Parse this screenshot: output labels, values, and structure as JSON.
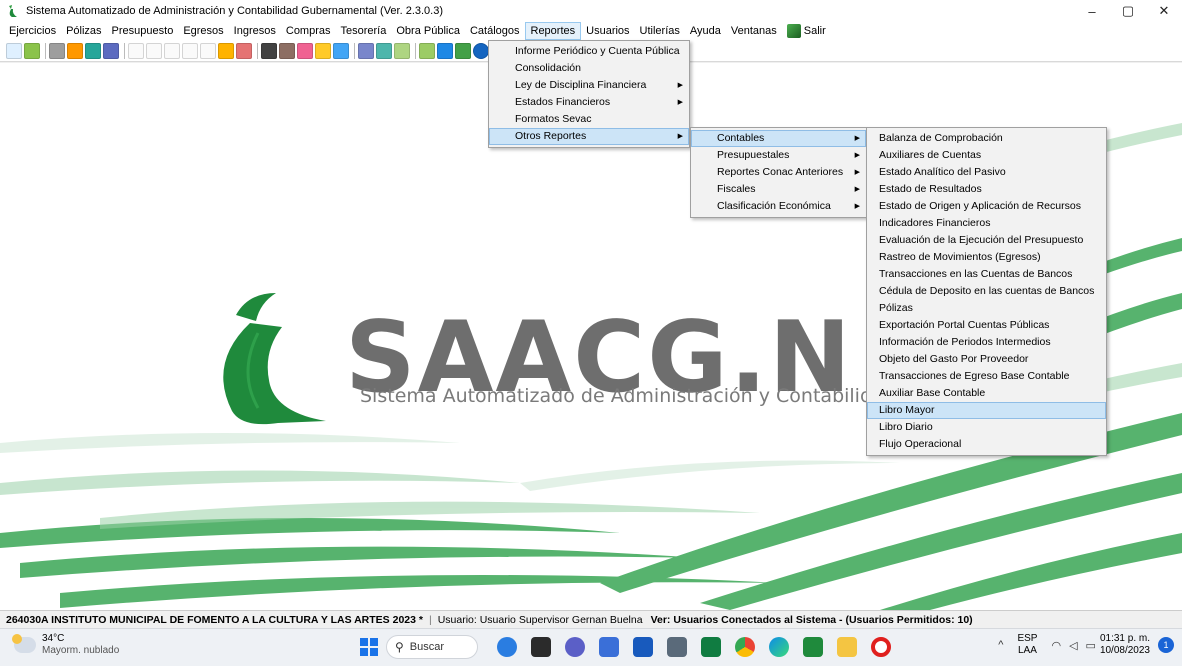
{
  "window": {
    "title": "Sistema Automatizado de Administración y Contabilidad Gubernamental  (Ver. 2.3.0.3)",
    "controls": [
      "–",
      "▢",
      "✕"
    ]
  },
  "menubar": {
    "items": [
      "Ejercicios",
      "Pólizas",
      "Presupuesto",
      "Egresos",
      "Ingresos",
      "Compras",
      "Tesorería",
      "Obra Pública",
      "Catálogos",
      "Reportes",
      "Usuarios",
      "Utilerías",
      "Ayuda",
      "Ventanas",
      "Salir"
    ]
  },
  "menus": {
    "reportes": [
      {
        "label": "Informe Periódico y Cuenta Pública",
        "submenu": false
      },
      {
        "label": "Consolidación",
        "submenu": false
      },
      {
        "label": "Ley de Disciplina Financiera",
        "submenu": true
      },
      {
        "label": "Estados Financieros",
        "submenu": true
      },
      {
        "label": "Formatos Sevac",
        "submenu": false
      },
      {
        "label": "Otros Reportes",
        "submenu": true
      }
    ],
    "otros": [
      {
        "label": "Contables",
        "submenu": true
      },
      {
        "label": "Presupuestales",
        "submenu": true
      },
      {
        "label": "Reportes Conac Anteriores",
        "submenu": true
      },
      {
        "label": "Fiscales",
        "submenu": true
      },
      {
        "label": "Clasificación Económica",
        "submenu": true
      }
    ],
    "contables": [
      "Balanza de Comprobación",
      "Auxiliares de Cuentas",
      "Estado Analítico del Pasivo",
      "Estado de Resultados",
      "Estado de Origen y Aplicación de Recursos",
      "Indicadores Financieros",
      "Evaluación de la Ejecución del Presupuesto",
      "Rastreo de  Movimientos (Egresos)",
      "Transacciones en las Cuentas de Bancos",
      "Cédula de Deposito en las cuentas de Bancos",
      "Pólizas",
      "Exportación Portal Cuentas Públicas",
      "Información de Periodos Intermedios",
      "Objeto del Gasto Por Proveedor",
      "Transacciones de Egreso Base Contable",
      "Auxiliar Base Contable",
      "Libro Mayor",
      "Libro Diario",
      "Flujo Operacional"
    ]
  },
  "logo": {
    "name": "SAACG.N",
    "subtitle": "Sistema Automatizado de Administración y Contabilidad"
  },
  "statusbar": {
    "institution": "264030A INSTITUTO MUNICIPAL DE FOMENTO A LA CULTURA Y LAS ARTES  2023  *",
    "user": "Usuario: Usuario Supervisor Gernan Buelna",
    "connected": "Ver: Usuarios Conectados al Sistema - (Usuarios Permitidos: 10)"
  },
  "taskbar": {
    "temp": "34°C",
    "weather": "Mayorm. nublado",
    "search_placeholder": "Buscar",
    "lang1": "ESP",
    "lang2": "LAA",
    "time": "01:31 p. m.",
    "date": "10/08/2023",
    "notifications": "1"
  },
  "colors": {
    "accent": "#cce4f7",
    "logo_green": "#1f8a3c",
    "logo_gray": "#6e6e6e"
  }
}
